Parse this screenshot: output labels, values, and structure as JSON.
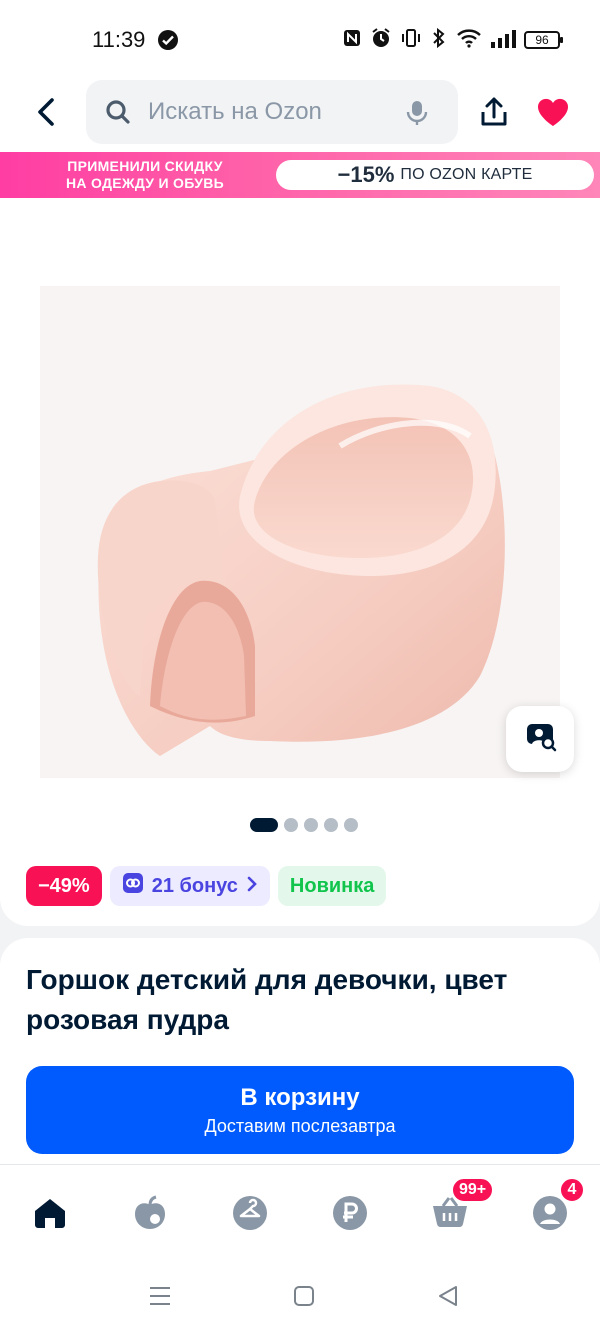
{
  "status_bar": {
    "time": "11:39",
    "battery": "96",
    "icons": [
      "nfc-icon",
      "alarm-icon",
      "vibrate-icon",
      "bluetooth-icon",
      "wifi-icon",
      "signal-icon",
      "battery-icon"
    ]
  },
  "header": {
    "search_placeholder": "Искать на Ozon",
    "favorite_color": "#f91155"
  },
  "promo": {
    "left_line1": "ПРИМЕНИЛИ СКИДКУ",
    "left_line2": "НА ОДЕЖДУ И ОБУВЬ",
    "discount": "−15%",
    "rest": "ПО OZON КАРТЕ"
  },
  "product": {
    "image_dots_total": 5,
    "image_dots_active": 1,
    "badges": {
      "discount": "−49%",
      "bonus": "21 бонус",
      "new": "Новинка"
    },
    "title": "Горшок детский для девочки, цвет розовая пудра",
    "cart_button": {
      "label": "В корзину",
      "sublabel": "Доставим послезавтра"
    }
  },
  "bottom_nav": {
    "items": [
      "home-icon",
      "fresh-icon",
      "clothes-icon",
      "finance-icon",
      "cart-icon",
      "profile-icon"
    ],
    "cart_badge": "99+",
    "profile_badge": "4"
  },
  "colors": {
    "accent_blue": "#005bff",
    "badge_red": "#f91155",
    "bonus_purple": "#4a44e0",
    "new_green": "#10c44c"
  }
}
